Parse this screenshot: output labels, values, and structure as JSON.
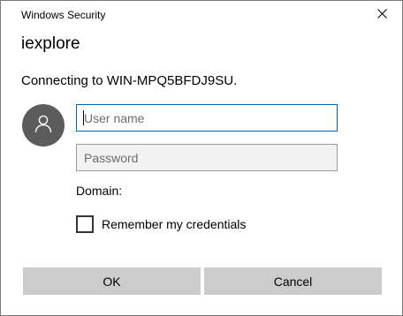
{
  "window": {
    "title": "Windows Security",
    "close_icon": "close-icon"
  },
  "app_name": "iexplore",
  "message": "Connecting to WIN-MPQ5BFDJ9SU.",
  "avatar_icon": "user-icon",
  "form": {
    "username": {
      "value": "",
      "placeholder": "User name"
    },
    "password": {
      "value": "",
      "placeholder": "Password"
    },
    "domain_label": "Domain:",
    "remember_label": "Remember my credentials",
    "remember_checked": false
  },
  "buttons": {
    "ok_label": "OK",
    "cancel_label": "Cancel"
  },
  "colors": {
    "focus_border": "#0063b1",
    "button_bg": "#cccccc",
    "avatar_bg": "#5c5c5c"
  }
}
